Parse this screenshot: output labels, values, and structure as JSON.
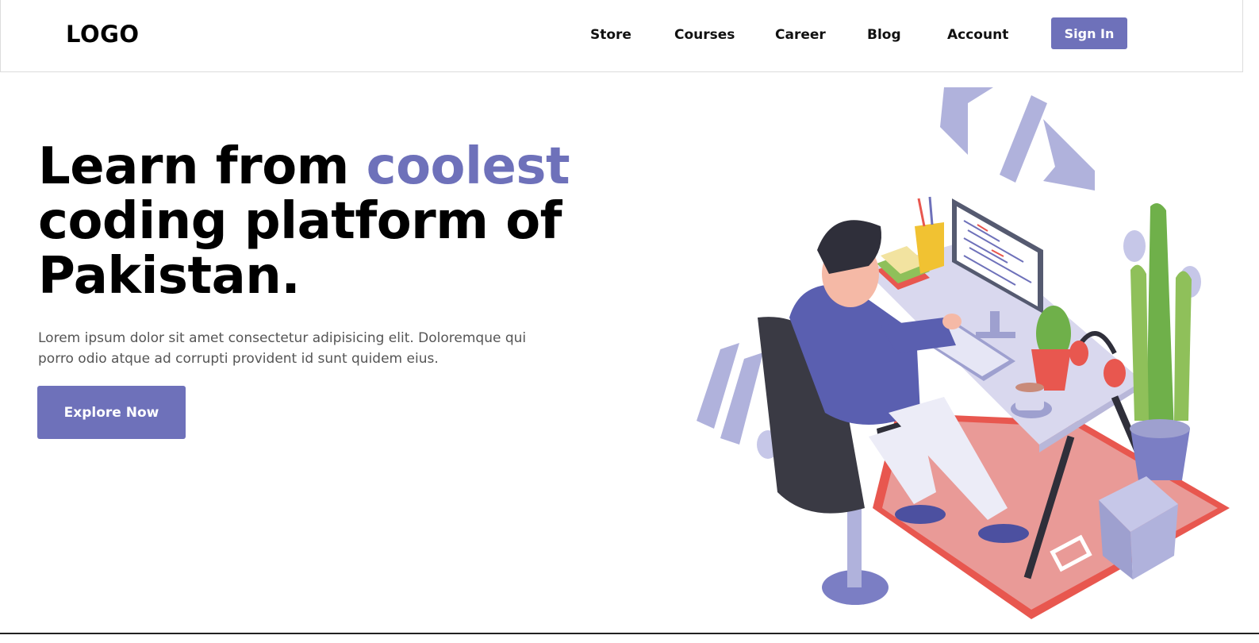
{
  "brand": {
    "logo_text": "LOGO"
  },
  "nav": {
    "links": [
      "Store",
      "Courses",
      "Career",
      "Blog",
      "Account"
    ],
    "signin_label": "Sign In"
  },
  "hero": {
    "title_part1": "Learn from ",
    "title_accent": "coolest",
    "title_part2": "coding platform of Pakistan.",
    "description": "Lorem ipsum dolor sit amet consectetur adipisicing elit. Doloremque qui porro odio atque ad corrupti provident id sunt quidem eius.",
    "cta_label": "Explore Now"
  },
  "illustration": {
    "code_symbol": "</>"
  },
  "colors": {
    "accent": "#6e71ba",
    "text_dark": "#000000",
    "text_muted": "#555555",
    "rug": "#e99a97",
    "rug_edge": "#e8574f",
    "desk": "#d9d8ee",
    "chair": "#3a3a44",
    "plant": "#6fb04a"
  }
}
